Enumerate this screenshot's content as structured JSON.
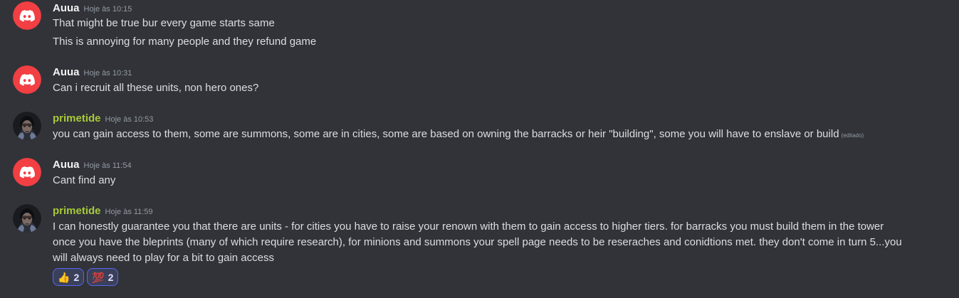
{
  "messages": [
    {
      "author": "Auua",
      "timestamp": "Hoje às 10:15",
      "lines": [
        "That might be true bur every game starts same",
        "This is annoying for many people and they refund game"
      ]
    },
    {
      "author": "Auua",
      "timestamp": "Hoje às 10:31",
      "lines": [
        "Can i recruit all these units, non hero ones?"
      ]
    },
    {
      "author": "primetide",
      "timestamp": "Hoje às 10:53",
      "lines": [
        "you can gain access to them, some are summons, some are in cities, some are based on owning the barracks or heir \"building\", some you will have to enslave or build"
      ],
      "edited": "(editado)"
    },
    {
      "author": "Auua",
      "timestamp": "Hoje às 11:54",
      "lines": [
        "Cant find any"
      ]
    },
    {
      "author": "primetide",
      "timestamp": "Hoje às 11:59",
      "lines": [
        "I can honestly guarantee you that there are units - for cities you have to raise your renown with them to gain access to higher tiers. for barracks you must build them in the tower",
        "once you have the bleprints (many of which require research), for minions and summons your spell page needs to be reseraches and conidtions met. they don't come in turn 5...you",
        "will always need to play for a bit to gain access"
      ],
      "reactions": [
        {
          "emoji": "thumbs-up",
          "glyph": "👍",
          "count": "2"
        },
        {
          "emoji": "hundred-points",
          "glyph": "💯",
          "count": "2"
        }
      ]
    }
  ],
  "colors": {
    "background": "#313338",
    "discord_avatar": "#f23f43",
    "primetide_name": "#a8c93a",
    "reaction_border": "#5865f2"
  }
}
